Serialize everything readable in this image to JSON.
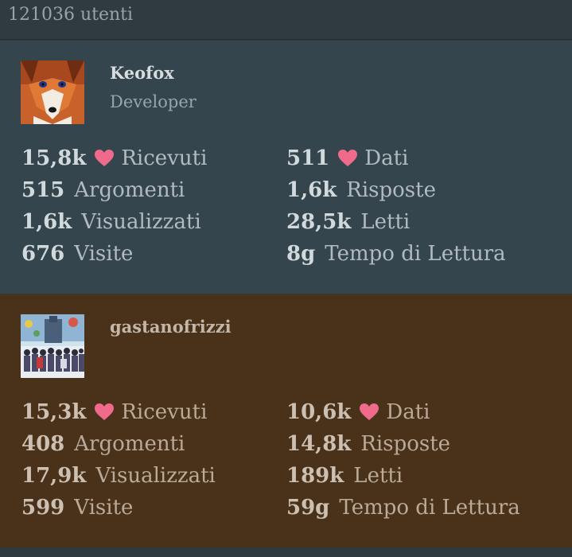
{
  "header": {
    "user_count": "121036 utenti"
  },
  "users": [
    {
      "username": "Keofox",
      "role": "Developer",
      "stats": {
        "likes_received": {
          "value": "15,8k",
          "label": "Ricevuti"
        },
        "likes_given": {
          "value": "511",
          "label": "Dati"
        },
        "topics": {
          "value": "515",
          "label": "Argomenti"
        },
        "replies": {
          "value": "1,6k",
          "label": "Risposte"
        },
        "viewed": {
          "value": "1,6k",
          "label": "Visualizzati"
        },
        "read": {
          "value": "28,5k",
          "label": "Letti"
        },
        "visits": {
          "value": "676",
          "label": "Visite"
        },
        "read_time": {
          "value": "8g",
          "label": "Tempo di Lettura"
        }
      }
    },
    {
      "username": "gastanofrizzi",
      "role": "",
      "stats": {
        "likes_received": {
          "value": "15,3k",
          "label": "Ricevuti"
        },
        "likes_given": {
          "value": "10,6k",
          "label": "Dati"
        },
        "topics": {
          "value": "408",
          "label": "Argomenti"
        },
        "replies": {
          "value": "14,8k",
          "label": "Risposte"
        },
        "viewed": {
          "value": "17,9k",
          "label": "Visualizzati"
        },
        "read": {
          "value": "189k",
          "label": "Letti"
        },
        "visits": {
          "value": "599",
          "label": "Visite"
        },
        "read_time": {
          "value": "59g",
          "label": "Tempo di Lettura"
        }
      }
    }
  ],
  "colors": {
    "heart": "#f06a8c",
    "card_one_bg": "#34454d",
    "card_two_bg": "#4a3119"
  },
  "icons": {
    "like": "heart-icon"
  }
}
